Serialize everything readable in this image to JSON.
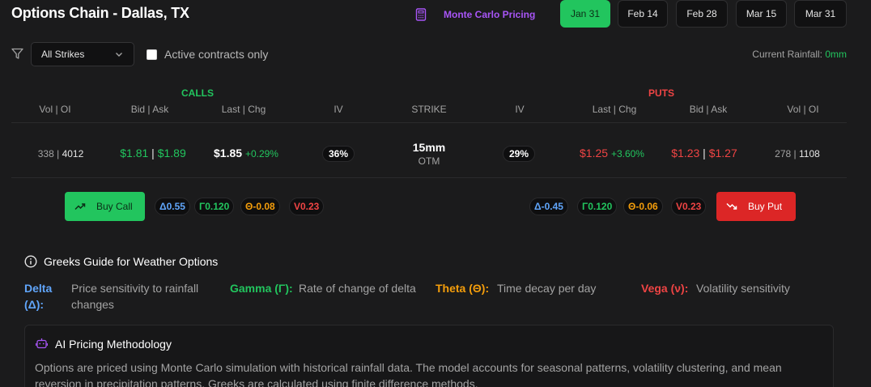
{
  "header": {
    "title": "Options Chain - Dallas, TX",
    "monte_carlo_label": "Monte Carlo Pricing",
    "dates": [
      {
        "label": "Jan 31",
        "active": true
      },
      {
        "label": "Feb 14",
        "active": false
      },
      {
        "label": "Feb 28",
        "active": false
      },
      {
        "label": "Mar 15",
        "active": false
      },
      {
        "label": "Mar 31",
        "active": false
      }
    ]
  },
  "filters": {
    "strike_select": "All Strikes",
    "active_only_label": "Active contracts only",
    "active_only_checked": false,
    "rainfall_label": "Current Rainfall:",
    "rainfall_value": "0mm"
  },
  "table": {
    "calls_label": "CALLS",
    "puts_label": "PUTS",
    "columns": [
      "Vol | OI",
      "Bid | Ask",
      "Last | Chg",
      "IV",
      "STRIKE",
      "IV",
      "Last | Chg",
      "Bid | Ask",
      "Vol | OI"
    ],
    "row": {
      "call_vol": "338",
      "call_oi": "4012",
      "call_bid": "$1.81",
      "call_ask": "$1.89",
      "call_last": "$1.85",
      "call_chg": "+0.29%",
      "call_iv": "36%",
      "strike": "15mm",
      "strike_status": "OTM",
      "put_iv": "29%",
      "put_last": "$1.25",
      "put_chg": "+3.60%",
      "put_bid": "$1.23",
      "put_ask": "$1.27",
      "put_vol": "278",
      "put_oi": "1108"
    },
    "separator": "|"
  },
  "actions": {
    "buy_call_label": "Buy Call",
    "buy_put_label": "Buy Put",
    "call_greeks": {
      "delta": "Δ0.55",
      "gamma": "Γ0.120",
      "theta": "Θ-0.08",
      "vega": "V0.23"
    },
    "put_greeks": {
      "delta": "Δ-0.45",
      "gamma": "Γ0.120",
      "theta": "Θ-0.06",
      "vega": "V0.23"
    }
  },
  "guide": {
    "title": "Greeks Guide for Weather Options",
    "items": [
      {
        "label": "Delta (Δ):",
        "desc": "Price sensitivity to rainfall changes"
      },
      {
        "label": "Gamma (Γ):",
        "desc": "Rate of change of delta"
      },
      {
        "label": "Theta (Θ):",
        "desc": "Time decay per day"
      },
      {
        "label": "Vega (ν):",
        "desc": "Volatility sensitivity"
      }
    ]
  },
  "methodology": {
    "title": "AI Pricing Methodology",
    "body": "Options are priced using Monte Carlo simulation with historical rainfall data. The model accounts for seasonal patterns, volatility clustering, and mean reversion in precipitation patterns. Greeks are calculated using finite difference methods."
  },
  "colors": {
    "calls": "#22c55e",
    "puts": "#ef4444",
    "accent_purple": "#a855f7",
    "delta": "#60a5fa",
    "theta": "#f59e0b"
  },
  "icons": [
    "calculator-icon",
    "filter-icon",
    "chevron-down-icon",
    "trending-up-icon",
    "trending-down-icon",
    "info-icon",
    "robot-icon"
  ]
}
